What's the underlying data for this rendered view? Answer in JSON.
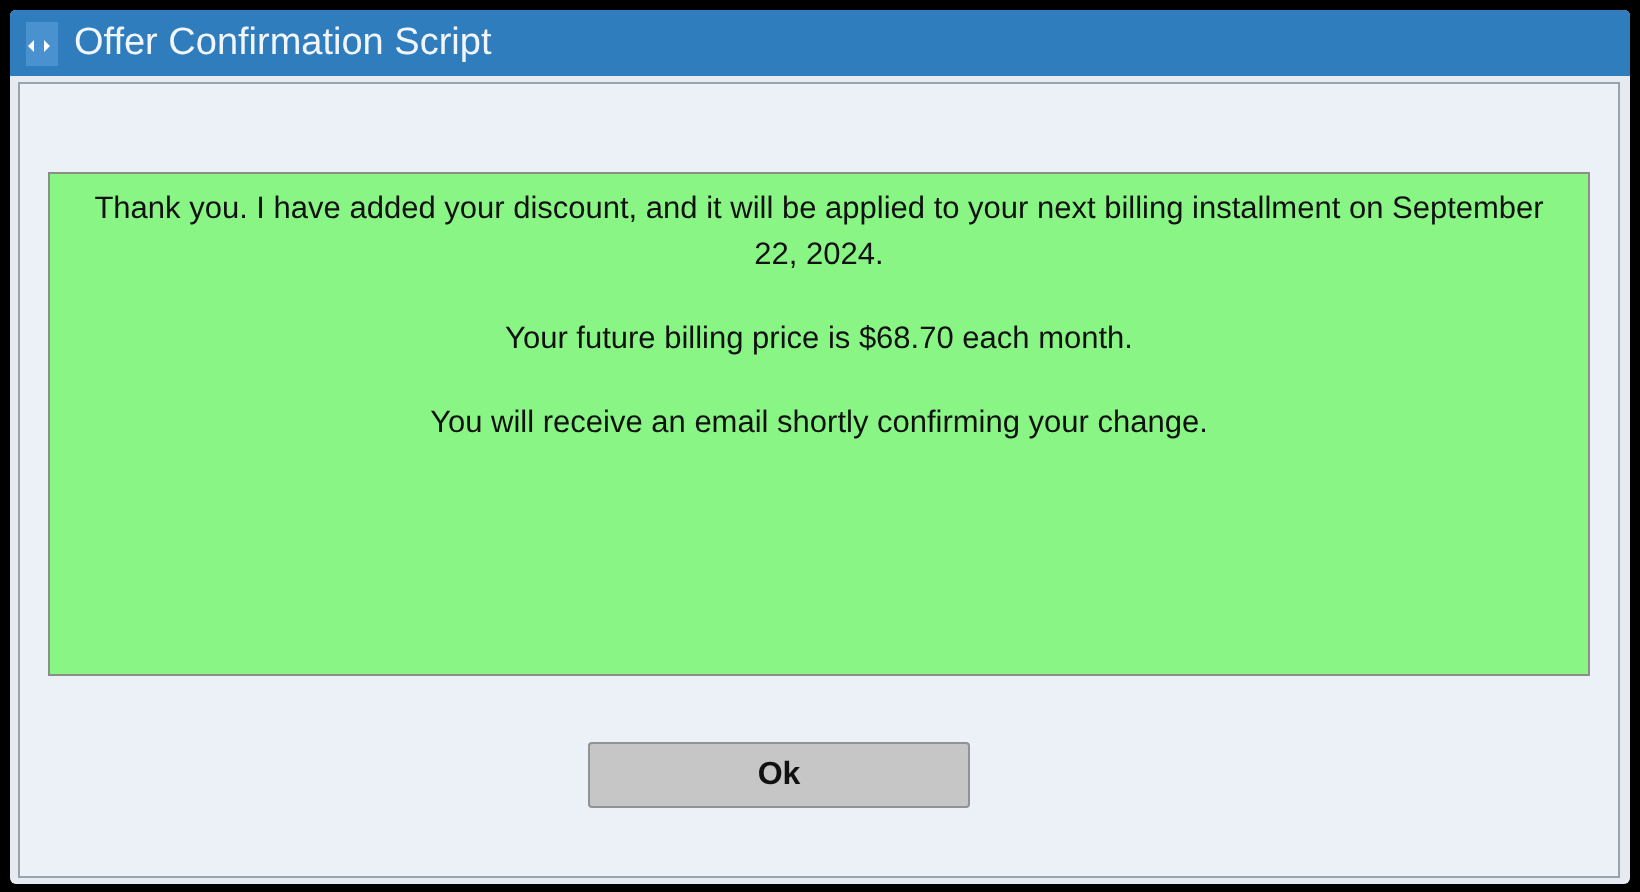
{
  "window": {
    "title": "Offer Confirmation Script"
  },
  "message": {
    "paragraphs": [
      "Thank you. I have added your discount, and it will be applied to your next billing installment on September 22, 2024.",
      "Your future billing price is $68.70 each month.",
      "You will receive an email shortly confirming your change."
    ]
  },
  "buttons": [
    "Ok"
  ]
}
